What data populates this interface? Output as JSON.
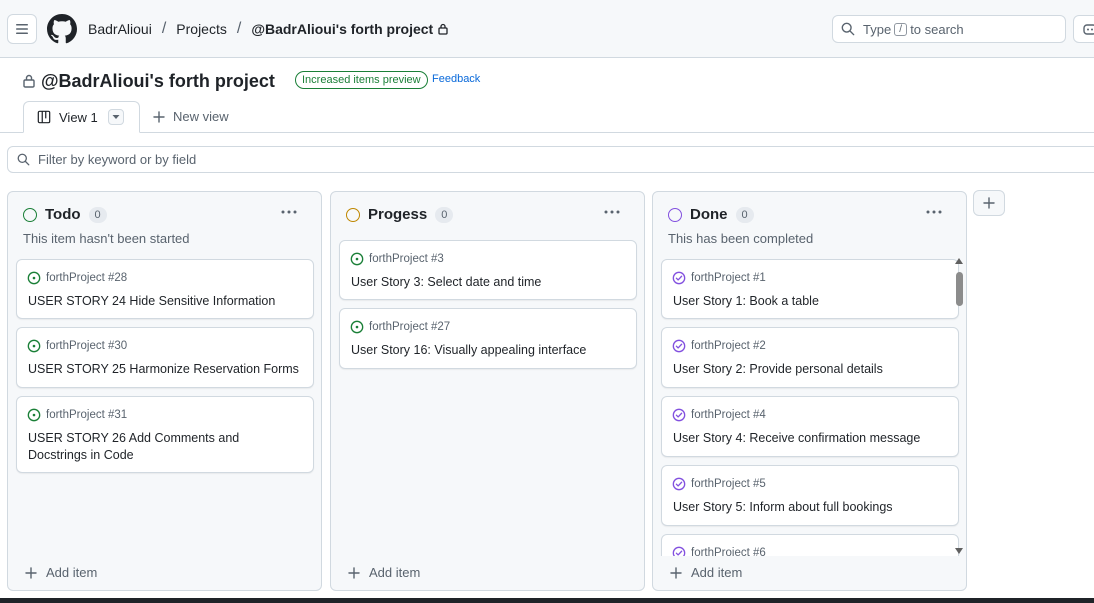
{
  "header": {
    "breadcrumbs": [
      "BadrAlioui",
      "Projects",
      "@BadrAlioui's forth project"
    ],
    "separator": "/",
    "search": {
      "before": "Type",
      "key": "/",
      "after": "to search"
    }
  },
  "project": {
    "title": "@BadrAlioui's forth project",
    "badge": "Increased items preview",
    "feedback": "Feedback"
  },
  "views": {
    "active": "View 1",
    "new_view": "New view"
  },
  "filter": {
    "placeholder": "Filter by keyword or by field"
  },
  "columns": [
    {
      "name": "Todo",
      "count": "0",
      "description": "This item hasn't been started",
      "color": "#1a7f37",
      "add_label": "Add item",
      "cards": [
        {
          "repo": "forthProject #28",
          "title": "USER STORY 24 Hide Sensitive Information"
        },
        {
          "repo": "forthProject #30",
          "title": "USER STORY 25 Harmonize Reservation Forms"
        },
        {
          "repo": "forthProject #31",
          "title": "USER STORY 26 Add Comments and Docstrings in Code"
        }
      ]
    },
    {
      "name": "Progess",
      "count": "0",
      "description": "",
      "color": "#bf8700",
      "add_label": "Add item",
      "cards": [
        {
          "repo": "forthProject #3",
          "title": "User Story 3: Select date and time"
        },
        {
          "repo": "forthProject #27",
          "title": "User Story 16: Visually appealing interface"
        }
      ]
    },
    {
      "name": "Done",
      "count": "0",
      "description": "This has been completed",
      "color": "#8250df",
      "add_label": "Add item",
      "cards": [
        {
          "repo": "forthProject #1",
          "title": "User Story 1: Book a table"
        },
        {
          "repo": "forthProject #2",
          "title": "User Story 2: Provide personal details"
        },
        {
          "repo": "forthProject #4",
          "title": "User Story 4: Receive confirmation message"
        },
        {
          "repo": "forthProject #5",
          "title": "User Story 5: Inform about full bookings"
        },
        {
          "repo": "forthProject #6",
          "title": ""
        }
      ]
    }
  ],
  "colors": {
    "open_issue": "#1a7f37",
    "closed_issue": "#8250df",
    "link": "#0969da",
    "border": "#d1d9e0"
  }
}
